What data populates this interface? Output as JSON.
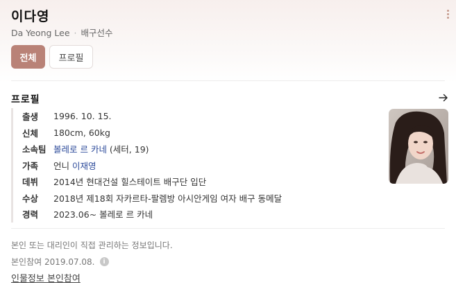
{
  "header": {
    "name": "이다영",
    "english_name": "Da Yeong Lee",
    "separator": "·",
    "occupation": "배구선수",
    "more_icon": "more-vertical-icon"
  },
  "tabs": [
    {
      "label": "전체",
      "active": true
    },
    {
      "label": "프로필",
      "active": false
    }
  ],
  "profile": {
    "title": "프로필",
    "arrow_icon": "arrow-right-icon",
    "rows": [
      {
        "key": "출생",
        "value": "1996. 10. 15."
      },
      {
        "key": "신체",
        "value": "180cm, 60kg"
      },
      {
        "key": "소속팀",
        "link": "볼레로 르 카네",
        "value": " (세터, 19)"
      },
      {
        "key": "가족",
        "prefix": "언니 ",
        "link": "이재영"
      },
      {
        "key": "데뷔",
        "value": "2014년 현대건설 힐스테이트 배구단 입단"
      },
      {
        "key": "수상",
        "value": "2018년 제18회 자카르타-팔렘방 아시안게임 여자 배구 동메달"
      },
      {
        "key": "경력",
        "value": "2023.06~ 볼레로 르 카네"
      }
    ]
  },
  "footer": {
    "notice": "본인 또는 대리인이 직접 관리하는 정보입니다.",
    "participation": "본인참여 2019.07.08.",
    "info_icon": "info-icon",
    "link": "인물정보 본인참여"
  },
  "colors": {
    "accent": "#b98277",
    "link": "#2c4a9a"
  }
}
